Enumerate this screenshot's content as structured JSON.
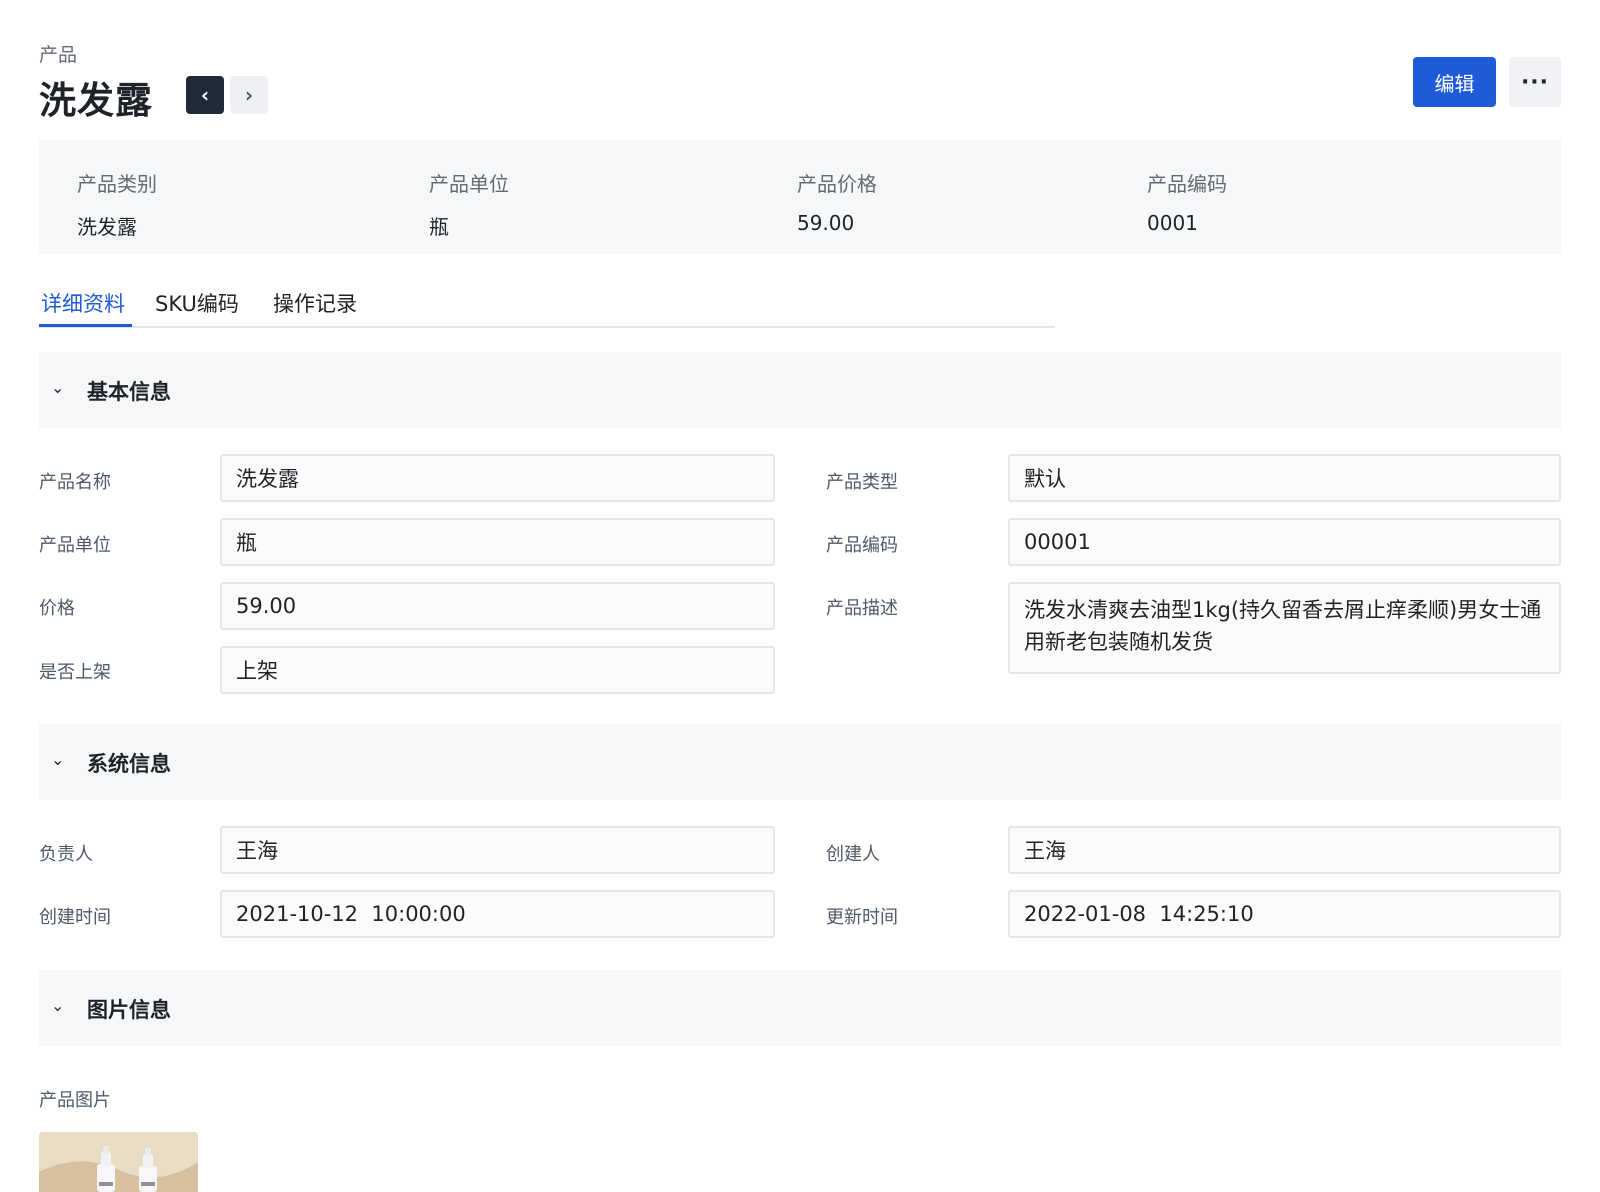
{
  "header": {
    "breadcrumb": "产品",
    "title": "洗发露",
    "prev_label": "‹",
    "next_label": "›",
    "edit_label": "编辑",
    "more_label": "···"
  },
  "summary": [
    {
      "label": "产品类别",
      "value": "洗发露"
    },
    {
      "label": "产品单位",
      "value": "瓶"
    },
    {
      "label": "产品价格",
      "value": "59.00"
    },
    {
      "label": "产品编码",
      "value": "0001"
    }
  ],
  "tabs": [
    {
      "label": "详细资料",
      "active": true
    },
    {
      "label": "SKU编码",
      "active": false
    },
    {
      "label": "操作记录",
      "active": false
    }
  ],
  "sections": {
    "basic": {
      "title": "基本信息",
      "fields": {
        "name": {
          "label": "产品名称",
          "value": "洗发露"
        },
        "type": {
          "label": "产品类型",
          "value": "默认"
        },
        "unit": {
          "label": "产品单位",
          "value": "瓶"
        },
        "code": {
          "label": "产品编码",
          "value": "00001"
        },
        "price": {
          "label": "价格",
          "value": "59.00"
        },
        "desc": {
          "label": "产品描述",
          "value": "洗发水清爽去油型1kg(持久留香去屑止痒柔顺)男女士通用新老包装随机发货"
        },
        "listed": {
          "label": "是否上架",
          "value": "上架"
        }
      }
    },
    "system": {
      "title": "系统信息",
      "fields": {
        "owner": {
          "label": "负责人",
          "value": "王海"
        },
        "creator": {
          "label": "创建人",
          "value": "王海"
        },
        "created_at": {
          "label": "创建时间",
          "value": "2021-10-12  10:00:00"
        },
        "updated_at": {
          "label": "更新时间",
          "value": "2022-01-08  14:25:10"
        }
      }
    },
    "images": {
      "title": "图片信息",
      "image_label": "产品图片"
    }
  },
  "icons": {
    "chevron": "chevron-down-icon",
    "prev": "chevron-left-icon",
    "next": "chevron-right-icon",
    "more": "more-icon"
  },
  "colors": {
    "primary": "#1d5bd8",
    "dark": "#1f2937",
    "panel": "#f6f7f9"
  }
}
